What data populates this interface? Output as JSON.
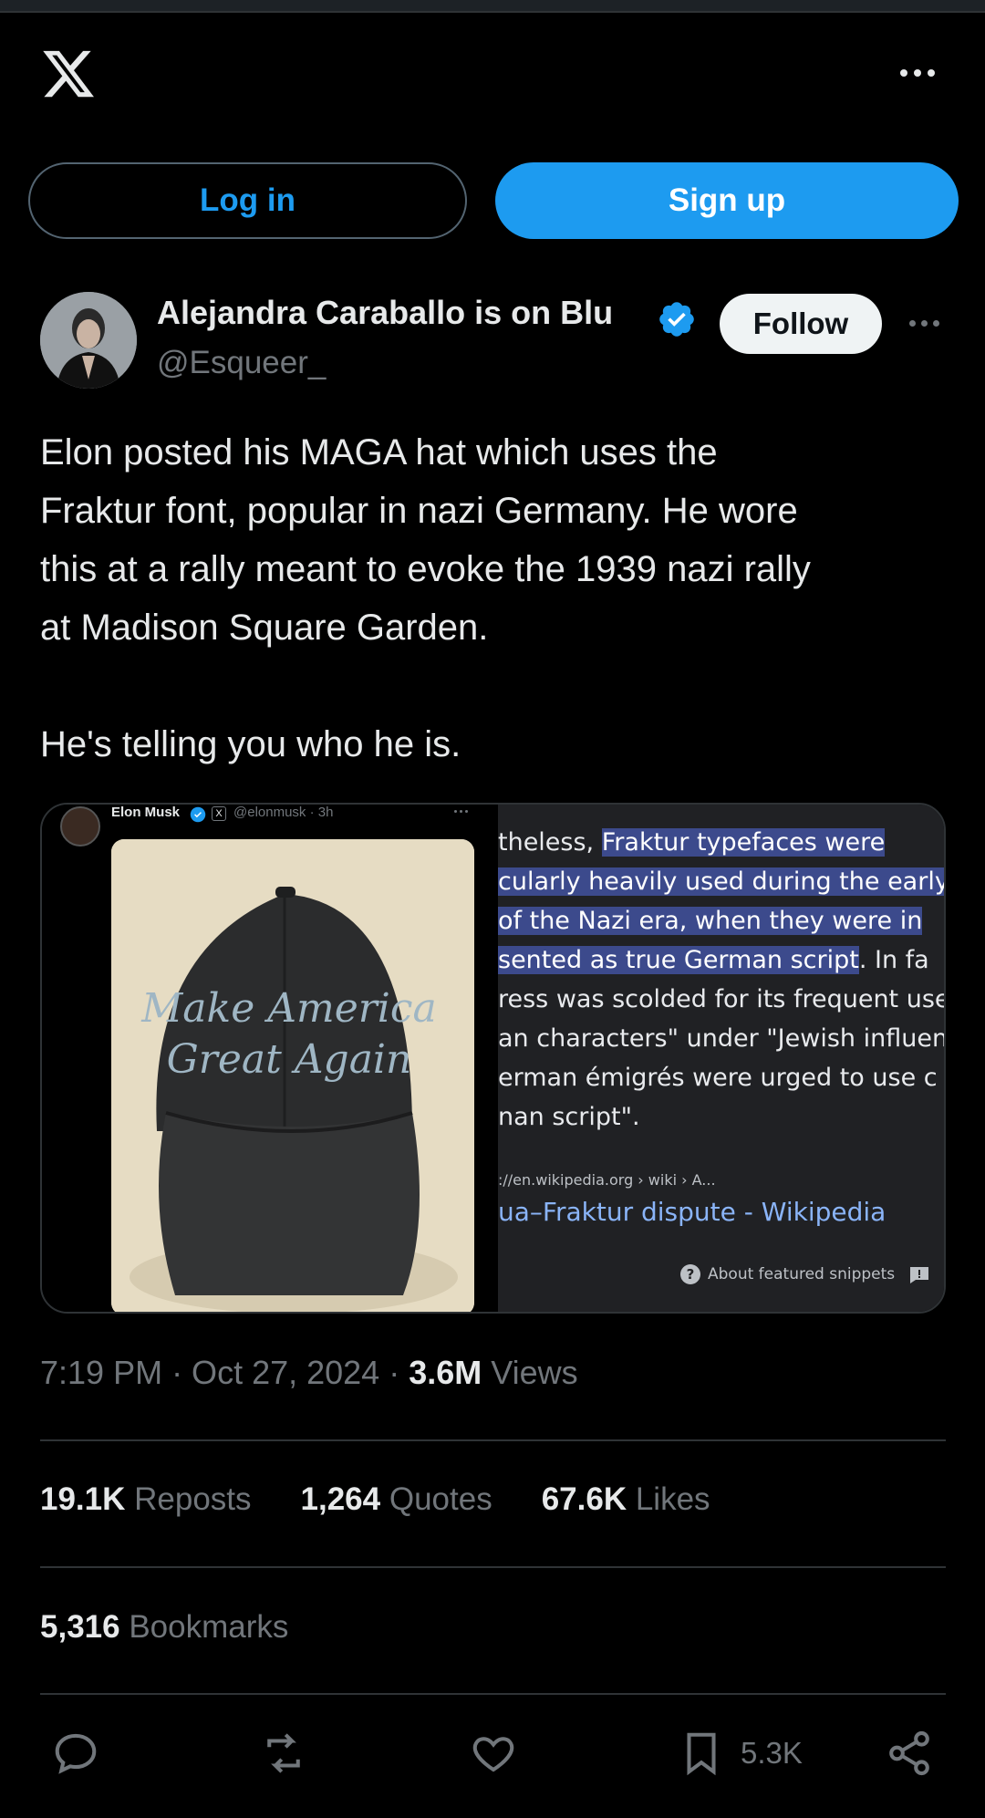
{
  "header": {
    "logo_icon": "x-logo-icon",
    "more_icon": "more-horizontal-icon"
  },
  "auth": {
    "login_label": "Log in",
    "signup_label": "Sign up"
  },
  "post": {
    "author_name": "Alejandra Caraballo is on Blu",
    "handle": "@Esqueer_",
    "follow_label": "Follow",
    "text_lines": [
      "Elon posted his MAGA hat which uses the",
      "Fraktur font, popular in nazi Germany. He wore",
      "this at a rally meant to evoke the 1939 nazi rally",
      "at Madison Square Garden."
    ],
    "text_line_2": "He's telling you who he is.",
    "media": {
      "inner_name": "Elon Musk",
      "inner_handle": "@elonmusk · 3h",
      "inner_x_badge": "X",
      "hat_text_line1": "Make America",
      "hat_text_line2": "Great Again",
      "snippet_lines": [
        {
          "pre": "theless, ",
          "hl": "Fraktur typefaces were",
          "post": ""
        },
        {
          "pre": "",
          "hl": "cularly heavily used during the early",
          "post": ""
        },
        {
          "pre": "",
          "hl": " of the Nazi era, when they were in",
          "post": ""
        },
        {
          "pre": "",
          "hl": "sented as true German script",
          "post": ". In fa"
        },
        {
          "pre": "ress was scolded for its frequent use",
          "hl": "",
          "post": ""
        },
        {
          "pre": "an characters\" under \"Jewish influen",
          "hl": "",
          "post": ""
        },
        {
          "pre": "erman émigrés were urged to use c",
          "hl": "",
          "post": ""
        },
        {
          "pre": "nan script\".",
          "hl": "",
          "post": ""
        }
      ],
      "snippet_url": "://en.wikipedia.org › wiki › A...",
      "snippet_link": "ua–Fraktur dispute - Wikipedia",
      "about_label": "About featured snippets"
    },
    "time": "7:19 PM · Oct 27, 2024 · ",
    "views_count": "3.6M",
    "views_label": " Views",
    "reposts_count": "19.1K",
    "reposts_label": " Reposts",
    "quotes_count": "1,264",
    "quotes_label": " Quotes",
    "likes_count": "67.6K",
    "likes_label": " Likes",
    "bookmarks_count": "5,316",
    "bookmarks_label": " Bookmarks",
    "bookmark_action_count": "5.3K"
  },
  "colors": {
    "accent": "#1d9bf0",
    "background": "#000000",
    "text": "#e7e9ea",
    "muted": "#71767b",
    "snippet_highlight": "#3c4a8c",
    "snippet_link": "#8ab4f8"
  }
}
